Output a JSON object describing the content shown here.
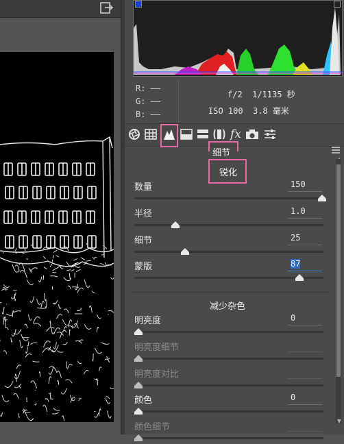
{
  "readout": {
    "r": "R: ——",
    "g": "G: ——",
    "b": "B: ——",
    "camera_line1": "f/2  1/1135 秒",
    "camera_line2": "ISO 100  3.8 毫米"
  },
  "panel": {
    "title": "细节",
    "sharpen": {
      "title": "锐化",
      "controls": [
        {
          "label": "数量",
          "value": "150",
          "level": 1.0
        },
        {
          "label": "半径",
          "value": "1.0",
          "level": 0.2
        },
        {
          "label": "细节",
          "value": "25",
          "level": 0.25
        },
        {
          "label": "蒙版",
          "value": "87",
          "level": 0.87
        }
      ]
    },
    "noise": {
      "title": "减少杂色",
      "controls": [
        {
          "label": "明亮度",
          "value": "0",
          "level": 0.0
        },
        {
          "label": "明亮度细节",
          "value": "",
          "level": 0.0
        },
        {
          "label": "明亮度对比",
          "value": "",
          "level": 0.0
        },
        {
          "label": "颜色",
          "value": "0",
          "level": 0.0
        },
        {
          "label": "颜色细节",
          "value": "",
          "level": 0.0
        }
      ]
    }
  },
  "tabs": [
    "lens-aperture-icon",
    "grid-icon",
    "mountain-detail-icon",
    "split-toning-icon",
    "hsl-bars-icon",
    "lens-profile-icon",
    "fx-icon",
    "camera-icon",
    "sliders-icon"
  ],
  "colors": {
    "highlight_frame": "#e56aa6",
    "active_value": "#5aa0ff"
  }
}
